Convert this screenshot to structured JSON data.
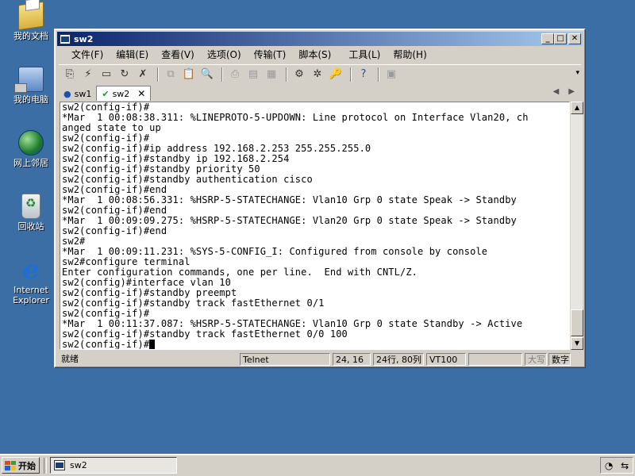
{
  "desktop": {
    "icons": [
      {
        "label": "我的文档",
        "icon": "my-documents-icon"
      },
      {
        "label": "我的电脑",
        "icon": "my-computer-icon"
      },
      {
        "label": "网上邻居",
        "icon": "network-places-icon"
      },
      {
        "label": "回收站",
        "icon": "recycle-bin-icon"
      },
      {
        "label": "Internet Explorer",
        "icon": "internet-explorer-icon"
      }
    ]
  },
  "window": {
    "title": "sw2",
    "controls": {
      "minimize": "_",
      "maximize": "□",
      "close": "✕"
    }
  },
  "menu": [
    "文件(F)",
    "编辑(E)",
    "查看(V)",
    "选项(O)",
    "传输(T)",
    "脚本(S)",
    "工具(L)",
    "帮助(H)"
  ],
  "tabs": [
    {
      "label": "sw1",
      "active": false,
      "icon": "disconnected-icon"
    },
    {
      "label": "sw2",
      "active": true,
      "icon": "connected-check-icon"
    }
  ],
  "terminal": {
    "lines": [
      "sw2(config-if)#",
      "*Mar  1 00:08:38.311: %LINEPROTO-5-UPDOWN: Line protocol on Interface Vlan20, ch",
      "anged state to up",
      "sw2(config-if)#",
      "sw2(config-if)#ip address 192.168.2.253 255.255.255.0",
      "sw2(config-if)#standby ip 192.168.2.254",
      "sw2(config-if)#standby priority 50",
      "sw2(config-if)#standby authentication cisco",
      "sw2(config-if)#end",
      "*Mar  1 00:08:56.331: %HSRP-5-STATECHANGE: Vlan10 Grp 0 state Speak -> Standby",
      "sw2(config-if)#end",
      "*Mar  1 00:09:09.275: %HSRP-5-STATECHANGE: Vlan20 Grp 0 state Speak -> Standby",
      "sw2(config-if)#end",
      "sw2#",
      "*Mar  1 00:09:11.231: %SYS-5-CONFIG_I: Configured from console by console",
      "sw2#configure terminal",
      "Enter configuration commands, one per line.  End with CNTL/Z.",
      "sw2(config)#interface vlan 10",
      "sw2(config-if)#standby preempt",
      "sw2(config-if)#standby track fastEthernet 0/1",
      "sw2(config-if)#",
      "*Mar  1 00:11:37.087: %HSRP-5-STATECHANGE: Vlan10 Grp 0 state Standby -> Active",
      "sw2(config-if)#standby track fastEthernet 0/0 100",
      "sw2(config-if)#"
    ]
  },
  "status": {
    "ready": "就绪",
    "protocol": "Telnet",
    "cursor_pos": "24, 16",
    "size": "24行, 80列",
    "emulation": "VT100",
    "caps": "大写",
    "num": "数字"
  },
  "taskbar": {
    "start_label": "开始",
    "task_label": "sw2"
  }
}
